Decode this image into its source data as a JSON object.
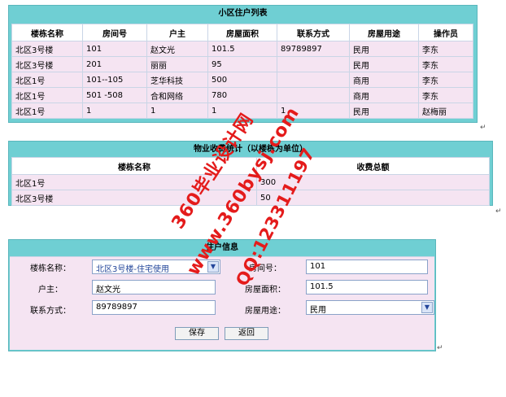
{
  "residents": {
    "title": "小区住户列表",
    "headers": [
      "楼栋名称",
      "房间号",
      "户主",
      "房屋面积",
      "联系方式",
      "房屋用途",
      "操作员"
    ],
    "rows": [
      [
        "北区3号楼",
        "101",
        "赵文光",
        "101.5",
        "89789897",
        "民用",
        "李东"
      ],
      [
        "北区3号楼",
        "201",
        "丽丽",
        "95",
        "",
        "民用",
        "李东"
      ],
      [
        "北区1号",
        "101--105",
        "芝华科技",
        "500",
        "",
        "商用",
        "李东"
      ],
      [
        "北区1号",
        "501 -508",
        "合和网络",
        "780",
        "",
        "商用",
        "李东"
      ],
      [
        "北区1号",
        "1",
        "1",
        "1",
        "1",
        "民用",
        "赵梅丽"
      ]
    ]
  },
  "fees": {
    "title": "物业收费统计（以楼栋为单位）",
    "headers": [
      "楼栋名称",
      "收费总额"
    ],
    "rows": [
      [
        "北区1号",
        "300"
      ],
      [
        "北区3号楼",
        "50"
      ]
    ]
  },
  "form": {
    "title": "住户信息",
    "building_label": "楼栋名称：",
    "building_value": "北区3号楼-住宅使用",
    "room_label": "房间号：",
    "room_value": "101",
    "owner_label": "户主：",
    "owner_value": "赵文光",
    "area_label": "房屋面积：",
    "area_value": "101.5",
    "contact_label": "联系方式：",
    "contact_value": "89789897",
    "usage_label": "房屋用途：",
    "usage_value": "民用",
    "save_label": "保存",
    "back_label": "返回"
  },
  "watermark": {
    "line1": "360毕业设计网",
    "line2": "www.360bysj.com",
    "line3": "QQ:123311197"
  },
  "return_mark": "↵"
}
